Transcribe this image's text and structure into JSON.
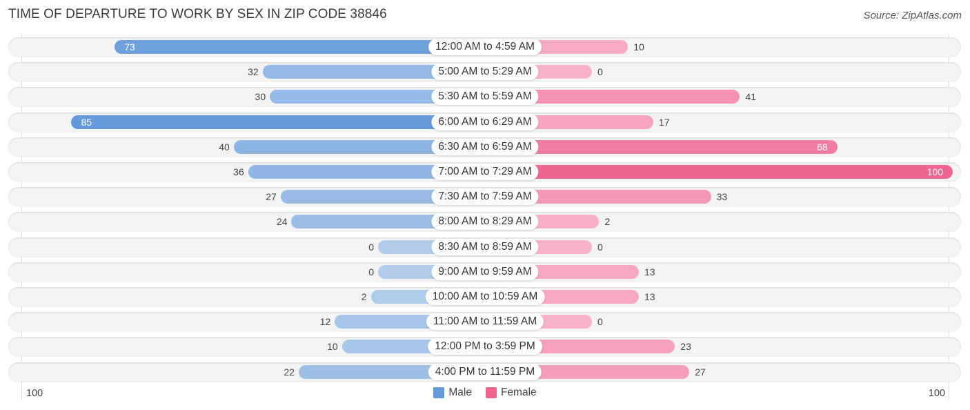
{
  "chart_data": {
    "type": "bar",
    "orientation": "horizontal-diverging",
    "title": "TIME OF DEPARTURE TO WORK BY SEX IN ZIP CODE 38846",
    "source": "Source: ZipAtlas.com",
    "categories": [
      "12:00 AM to 4:59 AM",
      "5:00 AM to 5:29 AM",
      "5:30 AM to 5:59 AM",
      "6:00 AM to 6:29 AM",
      "6:30 AM to 6:59 AM",
      "7:00 AM to 7:29 AM",
      "7:30 AM to 7:59 AM",
      "8:00 AM to 8:29 AM",
      "8:30 AM to 8:59 AM",
      "9:00 AM to 9:59 AM",
      "10:00 AM to 10:59 AM",
      "11:00 AM to 11:59 AM",
      "12:00 PM to 3:59 PM",
      "4:00 PM to 11:59 PM"
    ],
    "series": [
      {
        "name": "Male",
        "color": "#6399d8",
        "values": [
          73,
          32,
          30,
          85,
          40,
          36,
          27,
          24,
          0,
          0,
          2,
          12,
          10,
          22
        ]
      },
      {
        "name": "Female",
        "color": "#f06490",
        "values": [
          10,
          0,
          41,
          17,
          68,
          100,
          33,
          2,
          0,
          13,
          13,
          0,
          23,
          27
        ]
      }
    ],
    "axis": {
      "left_label": "100",
      "right_label": "100",
      "range": [
        0,
        100
      ]
    },
    "legend": {
      "position": "bottom-center",
      "items": [
        "Male",
        "Female"
      ]
    }
  }
}
